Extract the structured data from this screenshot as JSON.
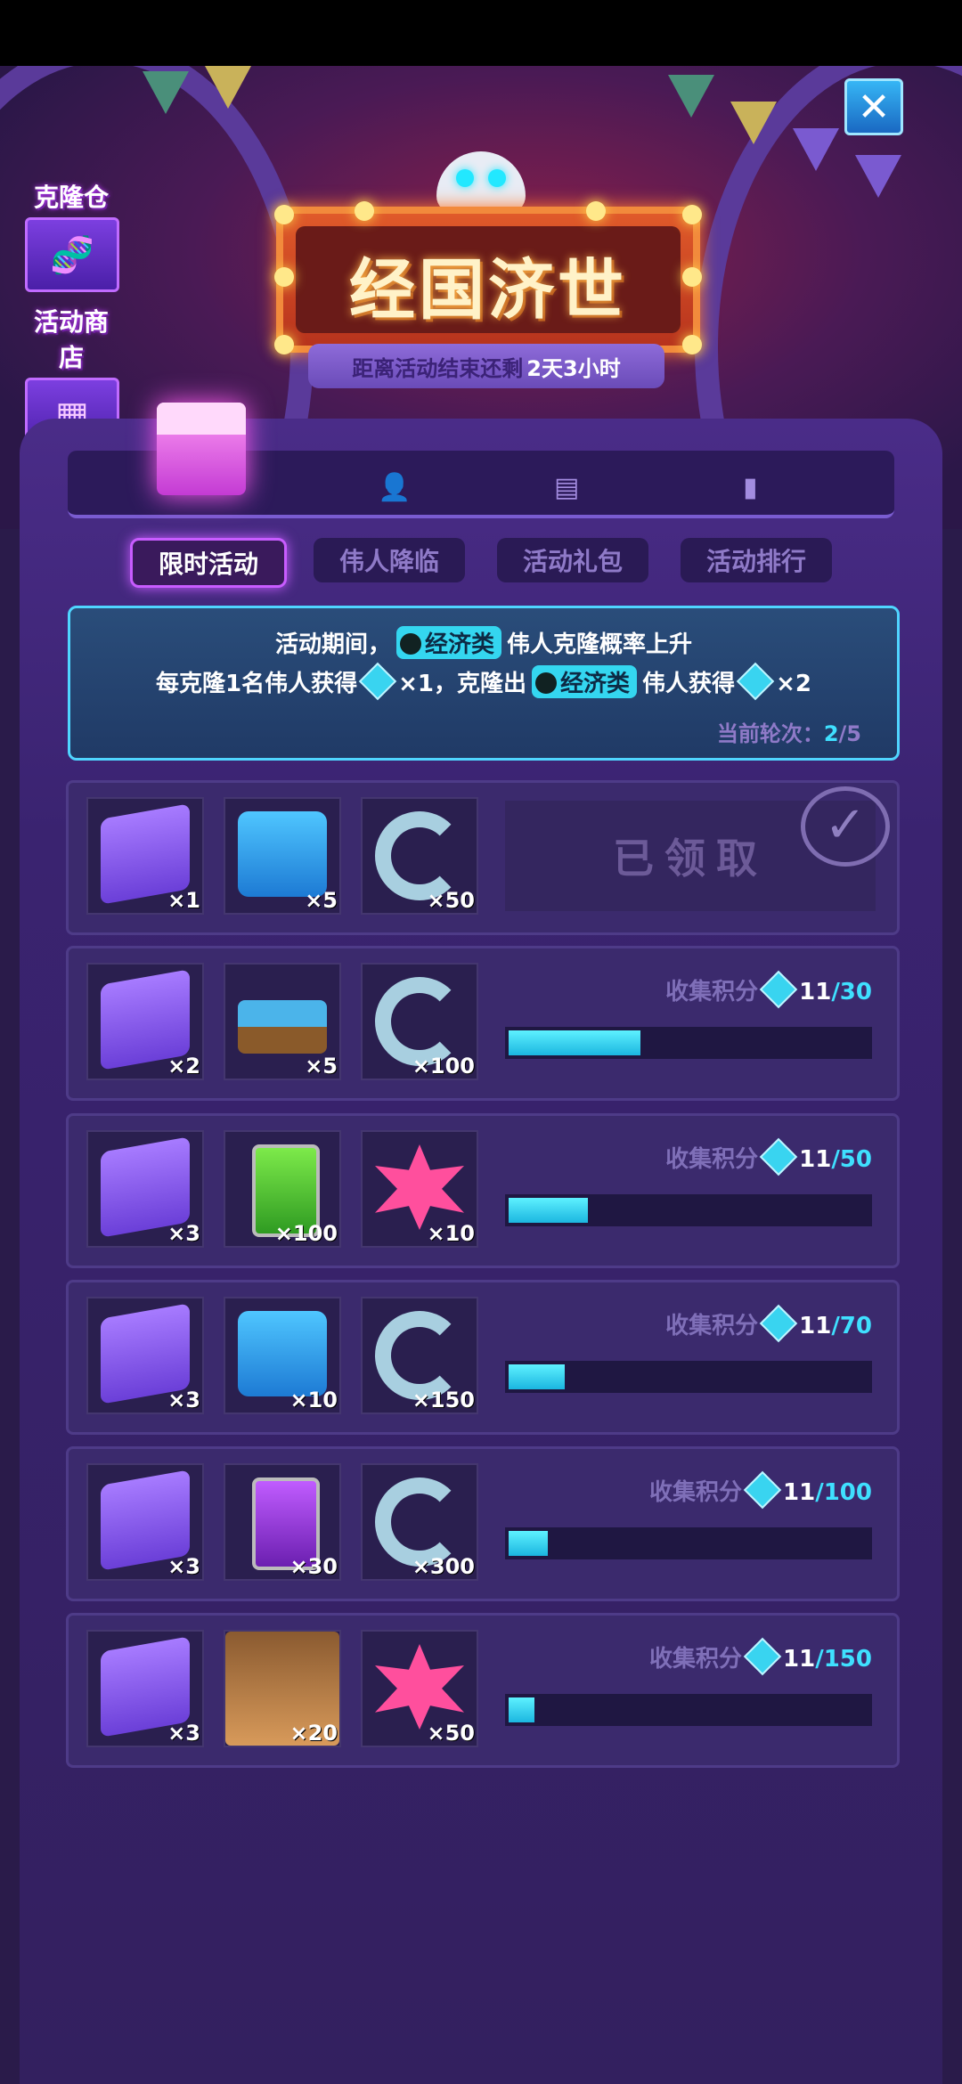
{
  "side_buttons": {
    "clone_bay": "克隆仓",
    "event_shop": "活动商店"
  },
  "banner": {
    "title": "经国济世",
    "countdown_prefix": "距离活动结束还剩",
    "countdown_value": "2天3小时"
  },
  "sub_tabs": [
    "限时活动",
    "伟人降临",
    "活动礼包",
    "活动排行"
  ],
  "info": {
    "line1_pre": "活动期间，",
    "tag": "经济类",
    "line1_post": "伟人克隆概率上升",
    "line2_a": "每克隆1名伟人获得",
    "line2_b": "×1，克隆出",
    "line2_c": "伟人获得",
    "line2_d": "×2",
    "round_label": "当前轮次：",
    "round_current": "2",
    "round_total": "/5"
  },
  "rewards": {
    "score_label": "收集积分",
    "claimed_label": "已领取",
    "rows": [
      {
        "items": [
          {
            "icon": "dna-card-icon",
            "count": "×1"
          },
          {
            "icon": "blue-house-book-icon",
            "count": "×5"
          },
          {
            "icon": "metal-ring-icon",
            "count": "×50"
          }
        ],
        "claimed": true
      },
      {
        "items": [
          {
            "icon": "dna-card-icon",
            "count": "×2"
          },
          {
            "icon": "blue-bed-icon",
            "count": "×5"
          },
          {
            "icon": "metal-ring-icon",
            "count": "×100"
          }
        ],
        "score": "11",
        "target": "/30",
        "progress": 0.367
      },
      {
        "items": [
          {
            "icon": "dna-card-icon",
            "count": "×3"
          },
          {
            "icon": "green-battery-icon",
            "count": "×100"
          },
          {
            "icon": "pink-star-crystal-icon",
            "count": "×10"
          }
        ],
        "score": "11",
        "target": "/50",
        "progress": 0.22
      },
      {
        "items": [
          {
            "icon": "dna-card-icon",
            "count": "×3"
          },
          {
            "icon": "blue-house-book-icon",
            "count": "×10"
          },
          {
            "icon": "metal-ring-icon",
            "count": "×150"
          }
        ],
        "score": "11",
        "target": "/70",
        "progress": 0.157
      },
      {
        "items": [
          {
            "icon": "dna-card-icon",
            "count": "×3"
          },
          {
            "icon": "purple-battery-icon",
            "count": "×30"
          },
          {
            "icon": "metal-ring-icon",
            "count": "×300"
          }
        ],
        "score": "11",
        "target": "/100",
        "progress": 0.11
      },
      {
        "items": [
          {
            "icon": "dna-card-icon",
            "count": "×3"
          },
          {
            "icon": "hero-portrait-icon",
            "count": "×20"
          },
          {
            "icon": "pink-star-crystal-icon",
            "count": "×50"
          }
        ],
        "score": "11",
        "target": "/150",
        "progress": 0.073
      }
    ]
  },
  "colors": {
    "accent": "#3fe0ff",
    "active_tab": "#c85cff",
    "sign": "#e05a2a"
  }
}
